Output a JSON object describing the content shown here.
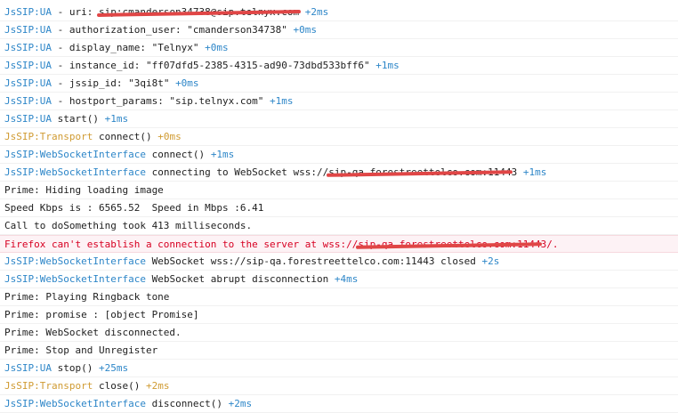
{
  "colors": {
    "namespace": "#2d86c8",
    "transport": "#d09b32",
    "error_text": "#d70022",
    "error_bg": "#fdf2f5",
    "redaction": "#e04646"
  },
  "lines": [
    {
      "ns": "JsSIP:UA",
      "pre": " - uri: ",
      "redacted": "sip:cmanderson34738@sip.telnyx.com",
      "post": " ",
      "time": "+2ms"
    },
    {
      "ns": "JsSIP:UA",
      "pre": " - authorization_user: \"cmanderson34738\" ",
      "time": "+0ms"
    },
    {
      "ns": "JsSIP:UA",
      "pre": " - display_name: \"Telnyx\" ",
      "time": "+0ms"
    },
    {
      "ns": "JsSIP:UA",
      "pre": " - instance_id: \"ff07dfd5-2385-4315-ad90-73dbd533bff6\" ",
      "time": "+1ms"
    },
    {
      "ns": "JsSIP:UA",
      "pre": " - jssip_id: \"3qi8t\" ",
      "time": "+0ms"
    },
    {
      "ns": "JsSIP:UA",
      "pre": " - hostport_params: \"sip.telnyx.com\" ",
      "time": "+1ms"
    },
    {
      "ns": "JsSIP:UA",
      "pre": " start() ",
      "time": "+1ms"
    },
    {
      "ns": "JsSIP:Transport",
      "kind": "transport",
      "pre": " connect() ",
      "time": "+0ms"
    },
    {
      "ns": "JsSIP:WebSocketInterface",
      "pre": " connect() ",
      "time": "+1ms"
    },
    {
      "ns": "JsSIP:WebSocketInterface",
      "pre": " connecting to WebSocket wss://",
      "redacted": "sip-qa.forestreettelco.com:1144",
      "post": "3 ",
      "time": "+1ms"
    },
    {
      "pre": "Prime: Hiding loading image"
    },
    {
      "pre": "Speed Kbps is : 6565.52  Speed in Mbps :6.41"
    },
    {
      "pre": "Call to doSomething took 413 milliseconds."
    },
    {
      "kind": "error",
      "pre": "Firefox can't establish a connection to the server at wss://",
      "redacted": "sip-qa.forestreettelco.com:1144",
      "post": "3/."
    },
    {
      "ns": "JsSIP:WebSocketInterface",
      "pre": " WebSocket wss://sip-qa.forestreettelco.com:11443 closed ",
      "time": "+2s"
    },
    {
      "ns": "JsSIP:WebSocketInterface",
      "pre": " WebSocket abrupt disconnection ",
      "time": "+4ms"
    },
    {
      "pre": "Prime: Playing Ringback tone"
    },
    {
      "pre": "Prime: promise : [object Promise]"
    },
    {
      "pre": "Prime: WebSocket disconnected."
    },
    {
      "pre": "Prime: Stop and Unregister"
    },
    {
      "ns": "JsSIP:UA",
      "pre": " stop() ",
      "time": "+25ms"
    },
    {
      "ns": "JsSIP:Transport",
      "kind": "transport",
      "pre": " close() ",
      "time": "+2ms"
    },
    {
      "ns": "JsSIP:WebSocketInterface",
      "pre": " disconnect() ",
      "time": "+2ms"
    }
  ]
}
